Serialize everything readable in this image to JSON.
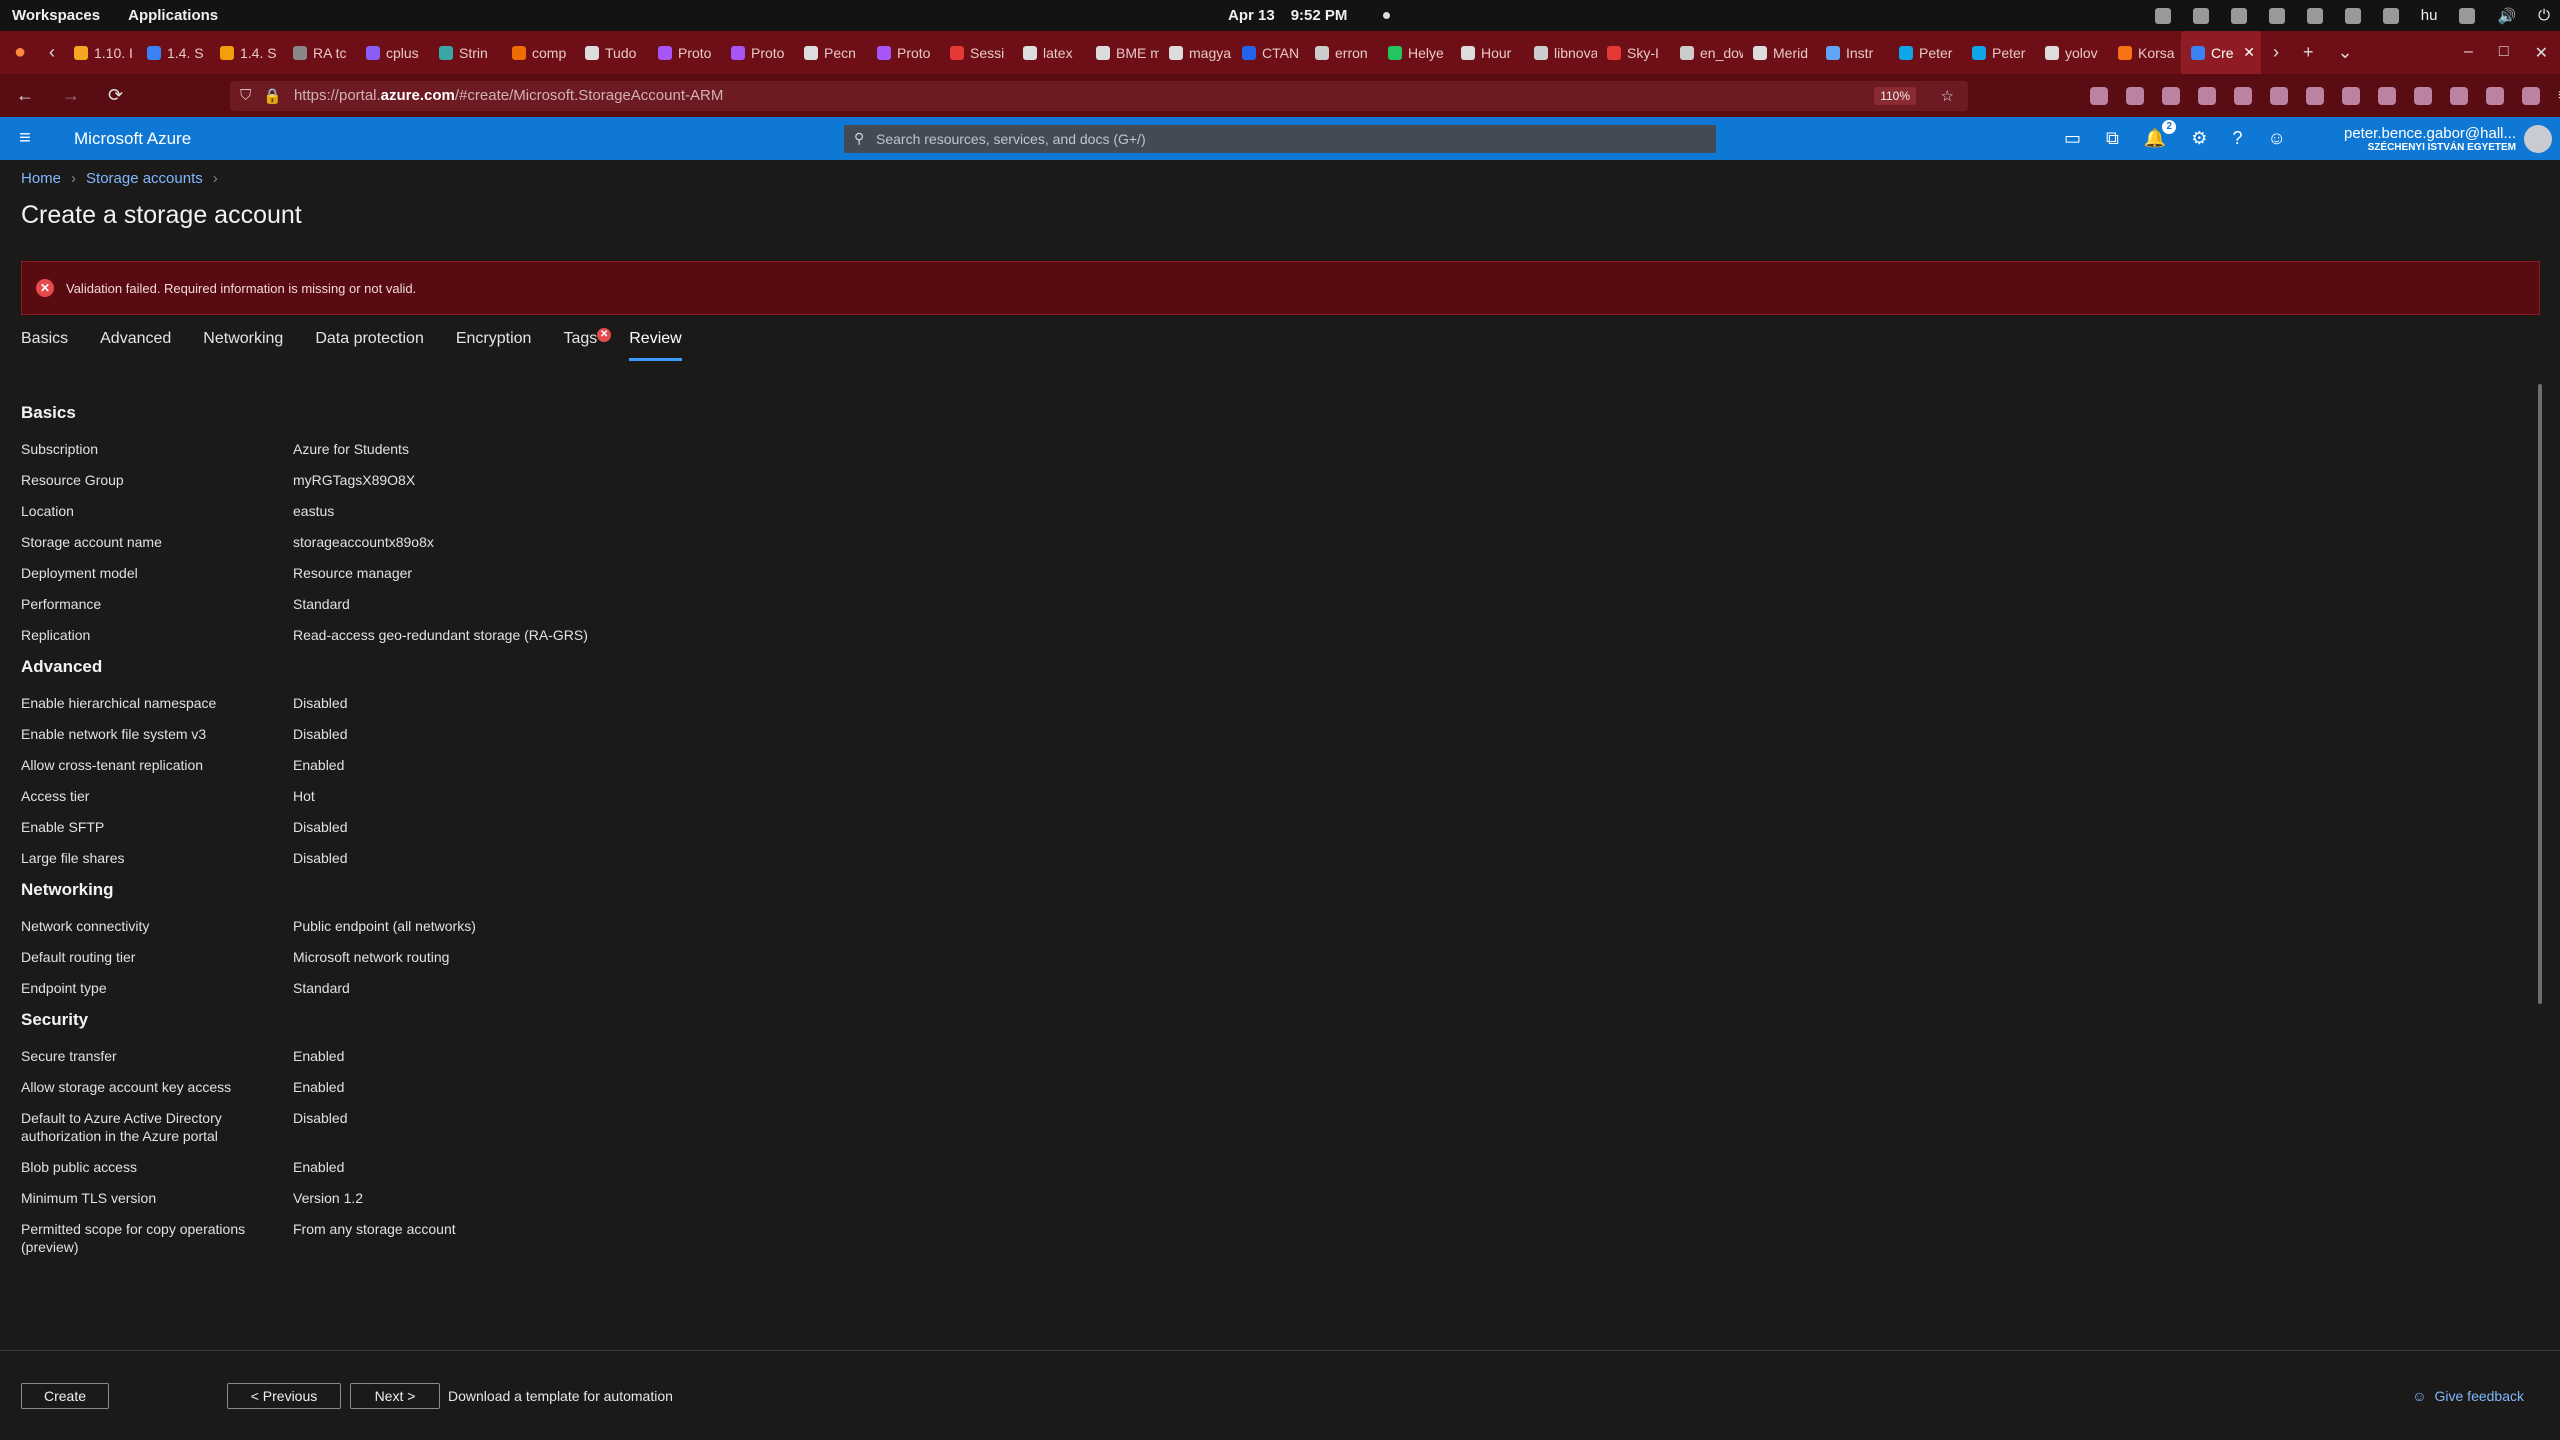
{
  "os": {
    "workspaces": "Workspaces",
    "applications": "Applications",
    "date": "Apr 13",
    "time": "9:52 PM",
    "lang": "hu"
  },
  "browser": {
    "tabs": [
      "1.10. I",
      "1.4. S",
      "1.4. S",
      "RA tc",
      "cplus",
      "Strin",
      "comp",
      "Tudo",
      "Proto",
      "Proto",
      "Pecn",
      "Proto",
      "Sessi",
      "latex",
      "BME mat",
      "magyarc",
      "CTAN",
      "erron",
      "Helye",
      "Hour",
      "libnova",
      "Sky-I",
      "en_down",
      "Merid",
      "Instr",
      "Peter",
      "Peter",
      "yolov",
      "Korsa",
      "Cre"
    ],
    "url_prefix": "https://portal.",
    "url_host": "azure.com",
    "url_path": "/#create/Microsoft.StorageAccount-ARM",
    "zoom": "110%"
  },
  "azure": {
    "brand": "Microsoft Azure",
    "search_placeholder": "Search resources, services, and docs (G+/)",
    "notifications": "2",
    "user_name": "peter.bence.gabor@hall...",
    "user_org": "SZÉCHENYI ISTVÁN EGYETEM"
  },
  "breadcrumb": {
    "home": "Home",
    "storage": "Storage accounts"
  },
  "page_title": "Create a storage account",
  "alert": "Validation failed. Required information is missing or not valid.",
  "steps": [
    "Basics",
    "Advanced",
    "Networking",
    "Data protection",
    "Encryption",
    "Tags",
    "Review"
  ],
  "sections": {
    "basics": {
      "title": "Basics",
      "rows": [
        [
          "Subscription",
          "Azure for Students"
        ],
        [
          "Resource Group",
          "myRGTagsX89O8X"
        ],
        [
          "Location",
          "eastus"
        ],
        [
          "Storage account name",
          "storageaccountx89o8x"
        ],
        [
          "Deployment model",
          "Resource manager"
        ],
        [
          "Performance",
          "Standard"
        ],
        [
          "Replication",
          "Read-access geo-redundant storage (RA-GRS)"
        ]
      ]
    },
    "advanced": {
      "title": "Advanced",
      "rows": [
        [
          "Enable hierarchical namespace",
          "Disabled"
        ],
        [
          "Enable network file system v3",
          "Disabled"
        ],
        [
          "Allow cross-tenant replication",
          "Enabled"
        ],
        [
          "Access tier",
          "Hot"
        ],
        [
          "Enable SFTP",
          "Disabled"
        ],
        [
          "Large file shares",
          "Disabled"
        ]
      ]
    },
    "networking": {
      "title": "Networking",
      "rows": [
        [
          "Network connectivity",
          "Public endpoint (all networks)"
        ],
        [
          "Default routing tier",
          "Microsoft network routing"
        ],
        [
          "Endpoint type",
          "Standard"
        ]
      ]
    },
    "security": {
      "title": "Security",
      "rows": [
        [
          "Secure transfer",
          "Enabled"
        ],
        [
          "Allow storage account key access",
          "Enabled"
        ],
        [
          "Default to Azure Active Directory authorization in the Azure portal",
          "Disabled"
        ],
        [
          "Blob public access",
          "Enabled"
        ],
        [
          "Minimum TLS version",
          "Version 1.2"
        ],
        [
          "Permitted scope for copy operations (preview)",
          "From any storage account"
        ]
      ]
    }
  },
  "footer": {
    "create": "Create",
    "previous": "< Previous",
    "next": "Next >",
    "download": "Download a template for automation",
    "feedback": "Give feedback"
  }
}
